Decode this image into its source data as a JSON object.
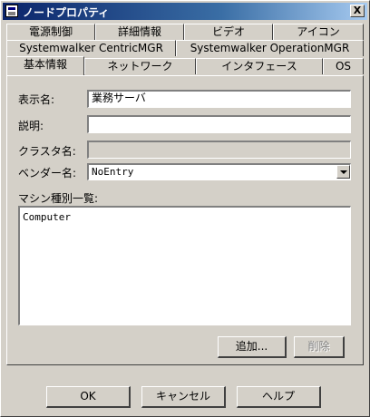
{
  "window": {
    "title": "ノードプロパティ",
    "close_label": "X"
  },
  "tabs_row1": [
    "電源制御",
    "詳細情報",
    "ビデオ",
    "アイコン"
  ],
  "tabs_row2": [
    "Systemwalker CentricMGR",
    "Systemwalker OperationMGR"
  ],
  "tabs_row3": [
    "基本情報",
    "ネットワーク",
    "インタフェース",
    "OS"
  ],
  "active_tab": "基本情報",
  "form": {
    "display_name_label": "表示名:",
    "display_name_value": "業務サーバ",
    "description_label": "説明:",
    "description_value": "",
    "cluster_name_label": "クラスタ名:",
    "cluster_name_value": "",
    "vendor_name_label": "ベンダー名:",
    "vendor_name_value": "NoEntry",
    "machine_type_list_label": "マシン種別一覧:",
    "machine_types": [
      "Computer"
    ]
  },
  "panel_buttons": {
    "add": "追加...",
    "delete": "削除"
  },
  "footer_buttons": {
    "ok": "OK",
    "cancel": "キャンセル",
    "help": "ヘルプ"
  }
}
